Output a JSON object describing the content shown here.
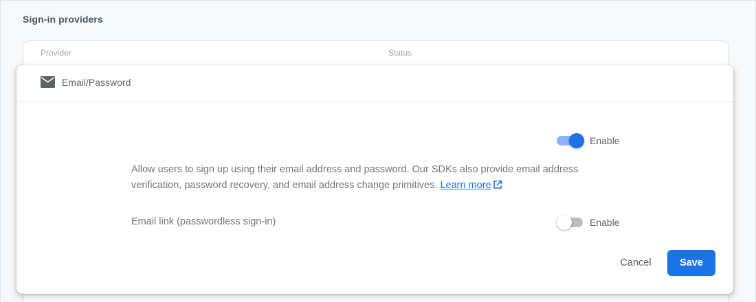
{
  "section": {
    "title": "Sign-in providers"
  },
  "table": {
    "columns": [
      "Provider",
      "Status"
    ]
  },
  "dialog": {
    "provider": {
      "name": "Email/Password",
      "icon": "mail-icon"
    },
    "email_password": {
      "enabled": true,
      "toggle_label": "Enable"
    },
    "description": "Allow users to sign up using their email address and password. Our SDKs also provide email address verification, password recovery, and email address change primitives.",
    "learn_more": "Learn more",
    "email_link": {
      "label": "Email link (passwordless sign-in)",
      "enabled": false,
      "toggle_label": "Enable"
    },
    "actions": {
      "cancel": "Cancel",
      "save": "Save"
    }
  },
  "colors": {
    "accent": "#1a73e8",
    "toggle_on_track": "#8ab4f8",
    "toggle_off_track": "#bdbdbd",
    "text_muted": "#757575"
  }
}
